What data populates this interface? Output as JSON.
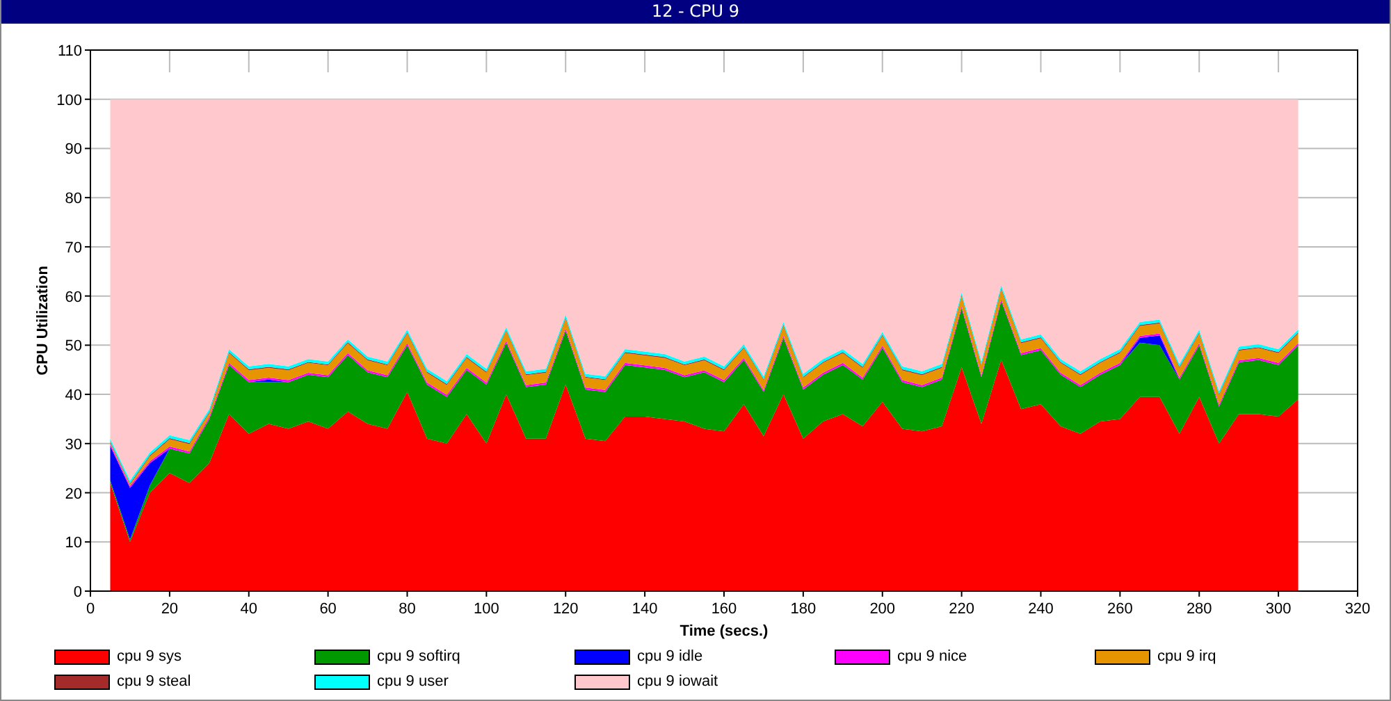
{
  "window": {
    "title": "12 - CPU 9"
  },
  "chart": {
    "chart_data": {
      "type": "area",
      "stacked": true,
      "grid": true,
      "xlabel": "Time (secs.)",
      "ylabel": "CPU Utilization",
      "xlim": [
        0,
        320
      ],
      "ylim": [
        0,
        110
      ],
      "xticks": [
        0,
        20,
        40,
        60,
        80,
        100,
        120,
        140,
        160,
        180,
        200,
        220,
        240,
        260,
        280,
        300,
        320
      ],
      "yticks": [
        0,
        10,
        20,
        30,
        40,
        50,
        60,
        70,
        80,
        90,
        100,
        110
      ],
      "x": [
        5,
        10,
        15,
        20,
        25,
        30,
        35,
        40,
        45,
        50,
        55,
        60,
        65,
        70,
        75,
        80,
        85,
        90,
        95,
        100,
        105,
        110,
        115,
        120,
        125,
        130,
        135,
        140,
        145,
        150,
        155,
        160,
        165,
        170,
        175,
        180,
        185,
        190,
        195,
        200,
        205,
        210,
        215,
        220,
        225,
        230,
        235,
        240,
        245,
        250,
        255,
        260,
        265,
        270,
        275,
        280,
        285,
        290,
        295,
        300,
        305
      ],
      "series": [
        {
          "name": "cpu 9 sys",
          "color": "#ff0000",
          "values": [
            22,
            10,
            20,
            24,
            22,
            26,
            36,
            32,
            34,
            33,
            34.5,
            33,
            36.5,
            34,
            33,
            40.5,
            31,
            30,
            36,
            30,
            40,
            31,
            31,
            42,
            31,
            30.5,
            35.5,
            35.5,
            35,
            34.5,
            33,
            32.5,
            38,
            31.5,
            40,
            31,
            34.5,
            36,
            33.5,
            38.5,
            33,
            32.5,
            33.5,
            45.5,
            34,
            47,
            37,
            38,
            33.5,
            32,
            34.5,
            35,
            39.5,
            39.5,
            32,
            39.5,
            30,
            36,
            36,
            35.5,
            39
          ]
        },
        {
          "name": "cpu 9 softirq",
          "color": "#009900",
          "values": [
            0.5,
            0.5,
            1.5,
            5,
            6,
            9,
            10,
            10.5,
            8.5,
            9.5,
            9.5,
            10.5,
            11.5,
            10.5,
            10.5,
            9.5,
            11,
            9.5,
            9,
            12,
            10.5,
            10.5,
            11,
            11,
            10,
            10,
            10.5,
            10,
            10,
            9,
            11.5,
            10,
            9,
            9,
            11.5,
            10,
            9.5,
            10,
            9.5,
            11,
            9.5,
            9,
            9.5,
            12,
            9.5,
            12,
            11,
            11,
            10.5,
            9.5,
            9.5,
            11,
            11,
            10.5,
            11,
            10.5,
            7.5,
            10.5,
            11,
            10.5,
            11
          ]
        },
        {
          "name": "cpu 9 idle",
          "color": "#0000ff",
          "values": [
            7,
            10.5,
            4.5,
            0,
            0,
            0,
            0,
            0,
            0.5,
            0,
            0,
            0,
            0,
            0,
            0,
            0,
            0,
            0,
            0,
            0,
            0,
            0,
            0,
            0,
            0,
            0,
            0,
            0,
            0,
            0,
            0,
            0,
            0,
            0,
            0,
            0,
            0,
            0,
            0,
            0,
            0,
            0,
            0,
            0,
            0,
            0,
            0,
            0,
            0,
            0,
            0,
            0,
            1,
            2,
            0,
            0,
            0,
            0,
            0,
            0,
            0
          ]
        },
        {
          "name": "cpu 9 nice",
          "color": "#ff00ff",
          "values": [
            0.4,
            0.4,
            0.4,
            0.4,
            0.4,
            0.4,
            0.4,
            0.4,
            0.4,
            0.4,
            0.4,
            0.4,
            0.4,
            0.4,
            0.4,
            0.4,
            0.4,
            0.4,
            0.4,
            0.4,
            0.4,
            0.4,
            0.4,
            0.4,
            0.4,
            0.4,
            0.4,
            0.4,
            0.4,
            0.4,
            0.4,
            0.4,
            0.4,
            0.4,
            0.4,
            0.4,
            0.4,
            0.4,
            0.4,
            0.4,
            0.4,
            0.4,
            0.4,
            0.4,
            0.4,
            0.4,
            0.4,
            0.4,
            0.4,
            0.4,
            0.4,
            0.4,
            0.4,
            0.4,
            0.4,
            0.4,
            0.4,
            0.4,
            0.4,
            0.4,
            0.4
          ]
        },
        {
          "name": "cpu 9 irq",
          "color": "#e69500",
          "values": [
            0.3,
            0.3,
            1,
            1.5,
            1.5,
            0.8,
            2,
            2,
            2,
            2,
            2,
            2,
            2,
            2,
            2,
            2,
            2,
            2,
            2,
            2,
            2,
            2,
            2,
            2,
            2,
            2,
            2,
            2,
            2,
            2,
            2,
            2,
            2,
            2,
            2,
            2,
            2,
            2,
            2,
            2,
            2,
            2,
            2,
            2,
            2,
            2,
            2,
            2,
            2,
            2,
            2,
            2,
            2,
            2,
            2,
            2,
            2,
            2,
            2,
            2,
            2
          ]
        },
        {
          "name": "cpu 9 steal",
          "color": "#a52a2a",
          "values": [
            0.2,
            0.2,
            0.2,
            0.2,
            0.2,
            0.2,
            0.2,
            0.2,
            0.2,
            0.2,
            0.2,
            0.2,
            0.2,
            0.2,
            0.2,
            0.2,
            0.2,
            0.2,
            0.2,
            0.2,
            0.2,
            0.2,
            0.2,
            0.2,
            0.2,
            0.2,
            0.2,
            0.2,
            0.2,
            0.2,
            0.2,
            0.2,
            0.2,
            0.2,
            0.2,
            0.2,
            0.2,
            0.2,
            0.2,
            0.2,
            0.2,
            0.2,
            0.2,
            0.2,
            0.2,
            0.2,
            0.2,
            0.2,
            0.2,
            0.2,
            0.2,
            0.2,
            0.2,
            0.2,
            0.2,
            0.2,
            0.2,
            0.2,
            0.2,
            0.2,
            0.2
          ]
        },
        {
          "name": "cpu 9 user",
          "color": "#00ffff",
          "values": [
            0.6,
            0.6,
            0.6,
            0.6,
            0.6,
            0.6,
            0.6,
            0.6,
            0.6,
            0.6,
            0.6,
            0.6,
            0.6,
            0.6,
            0.6,
            0.6,
            0.6,
            0.6,
            0.6,
            0.6,
            0.6,
            0.6,
            0.6,
            0.6,
            0.6,
            0.6,
            0.6,
            0.6,
            0.6,
            0.6,
            0.6,
            0.6,
            0.6,
            0.6,
            0.6,
            0.6,
            0.6,
            0.6,
            0.6,
            0.6,
            0.6,
            0.6,
            0.6,
            0.6,
            0.6,
            0.6,
            0.6,
            0.6,
            0.6,
            0.6,
            0.6,
            0.6,
            0.6,
            0.6,
            0.6,
            0.6,
            0.6,
            0.6,
            0.6,
            0.6,
            0.6
          ]
        },
        {
          "name": "cpu 9 iowait",
          "color": "#ffc8cc",
          "values": [
            69,
            77.5,
            71.8,
            68.3,
            69.3,
            63,
            50.8,
            54.3,
            53.8,
            54.3,
            52.8,
            53.3,
            48.8,
            52.3,
            53.3,
            46.8,
            54.8,
            57.3,
            51.8,
            54.8,
            46.3,
            55.3,
            54.8,
            43.8,
            55.8,
            56.3,
            50.8,
            51.3,
            51.8,
            53.3,
            52.3,
            54.3,
            49.8,
            56.3,
            45.3,
            55.8,
            52.8,
            50.8,
            53.8,
            47.3,
            54.3,
            55.3,
            53.8,
            39.3,
            53.3,
            37.8,
            48.8,
            47.8,
            52.8,
            55.3,
            52.8,
            50.8,
            45.3,
            44.8,
            53.8,
            46.8,
            59.3,
            50.3,
            49.8,
            50.8,
            46.8
          ]
        }
      ]
    }
  }
}
